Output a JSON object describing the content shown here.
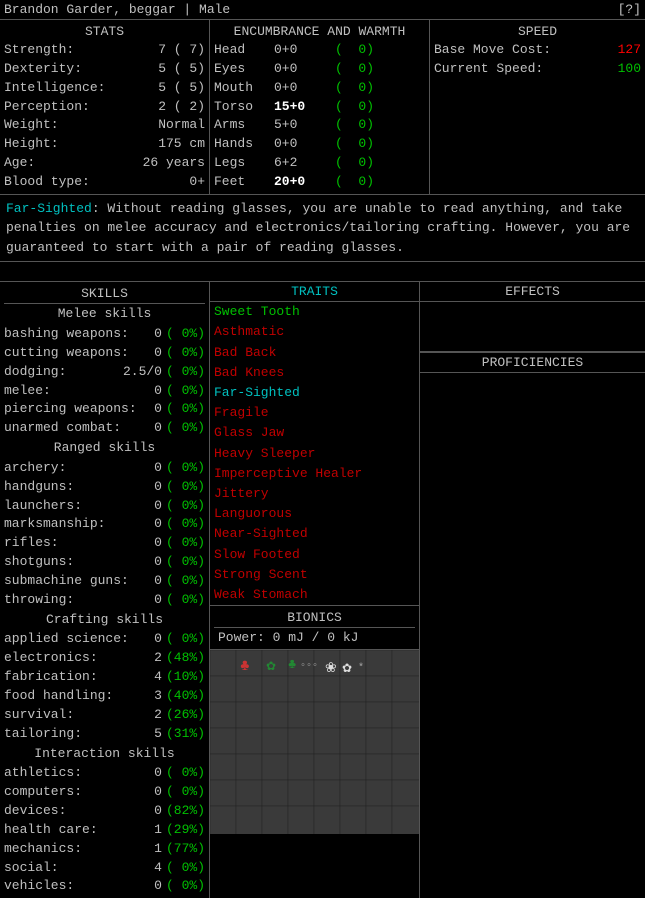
{
  "topbar": {
    "char_info": "Brandon Garder, beggar | Male",
    "help": "[?]"
  },
  "stats_header": "STATS",
  "stats": [
    {
      "label": "Strength:",
      "value": "7 ( 7)"
    },
    {
      "label": "Dexterity:",
      "value": "5 ( 5)"
    },
    {
      "label": "Intelligence:",
      "value": "5 ( 5)"
    },
    {
      "label": "Perception:",
      "value": "2 ( 2)"
    },
    {
      "label": "Weight:",
      "value": "Normal"
    },
    {
      "label": "Height:",
      "value": "175 cm"
    },
    {
      "label": "Age:",
      "value": "26 years"
    },
    {
      "label": "Blood type:",
      "value": "0+"
    }
  ],
  "enc_header": "ENCUMBRANCE AND WARMTH",
  "enc": [
    {
      "part": "Head",
      "val": "0+0",
      "warm": "0)"
    },
    {
      "part": "Eyes",
      "val": "0+0",
      "warm": "0)"
    },
    {
      "part": "Mouth",
      "val": "0+0",
      "warm": "0)"
    },
    {
      "part": "Torso",
      "val": "15+0",
      "warm": "0)",
      "highlight": true
    },
    {
      "part": "Arms",
      "val": "5+0",
      "warm": "0)"
    },
    {
      "part": "Hands",
      "val": "0+0",
      "warm": "0)"
    },
    {
      "part": "Legs",
      "val": "6+2",
      "warm": "0)"
    },
    {
      "part": "Feet",
      "val": "20+0",
      "warm": "0)",
      "highlight": true
    }
  ],
  "speed_header": "SPEED",
  "speed": {
    "base_label": "Base Move Cost:",
    "base_val": "127",
    "current_label": "Current Speed:",
    "current_val": "100"
  },
  "desc": {
    "highlight_word": "Far-Sighted",
    "text": ": Without reading glasses, you are unable to read anything, and take penalties on melee accuracy and electronics/tailoring crafting.  However, you are guaranteed to start with a pair of reading glasses."
  },
  "skills_header": "SKILLS",
  "melee_header": "Melee skills",
  "melee_skills": [
    {
      "name": "bashing weapons:",
      "val": "0",
      "pct": "( 0%)"
    },
    {
      "name": "cutting weapons:",
      "val": "0",
      "pct": "( 0%)"
    },
    {
      "name": "dodging:",
      "val": "2.5/0",
      "pct": "( 0%)"
    },
    {
      "name": "melee:",
      "val": "0",
      "pct": "( 0%)"
    },
    {
      "name": "piercing weapons:",
      "val": "0",
      "pct": "( 0%)"
    },
    {
      "name": "unarmed combat:",
      "val": "0",
      "pct": "( 0%)"
    }
  ],
  "ranged_header": "Ranged skills",
  "ranged_skills": [
    {
      "name": "archery:",
      "val": "0",
      "pct": "( 0%)"
    },
    {
      "name": "handguns:",
      "val": "0",
      "pct": "( 0%)"
    },
    {
      "name": "launchers:",
      "val": "0",
      "pct": "( 0%)"
    },
    {
      "name": "marksmanship:",
      "val": "0",
      "pct": "( 0%)"
    },
    {
      "name": "rifles:",
      "val": "0",
      "pct": "( 0%)"
    },
    {
      "name": "shotguns:",
      "val": "0",
      "pct": "( 0%)"
    },
    {
      "name": "submachine guns:",
      "val": "0",
      "pct": "( 0%)"
    },
    {
      "name": "throwing:",
      "val": "0",
      "pct": "( 0%)"
    }
  ],
  "crafting_header": "Crafting skills",
  "crafting_skills": [
    {
      "name": "applied science:",
      "val": "0",
      "pct": "( 0%)"
    },
    {
      "name": "electronics:",
      "val": "2",
      "pct": "(48%)"
    },
    {
      "name": "fabrication:",
      "val": "4",
      "pct": "(10%)"
    },
    {
      "name": "food handling:",
      "val": "3",
      "pct": "(40%)"
    },
    {
      "name": "survival:",
      "val": "2",
      "pct": "(26%)"
    },
    {
      "name": "tailoring:",
      "val": "5",
      "pct": "(31%)"
    }
  ],
  "interaction_header": "Interaction skills",
  "interaction_skills": [
    {
      "name": "athletics:",
      "val": "0",
      "pct": "( 0%)"
    },
    {
      "name": "computers:",
      "val": "0",
      "pct": "( 0%)"
    },
    {
      "name": "devices:",
      "val": "0",
      "pct": "(82%)"
    },
    {
      "name": "health care:",
      "val": "1",
      "pct": "(29%)"
    },
    {
      "name": "mechanics:",
      "val": "1",
      "pct": "(77%)"
    },
    {
      "name": "social:",
      "val": "4",
      "pct": "( 0%)"
    },
    {
      "name": "vehicles:",
      "val": "0",
      "pct": "( 0%)"
    }
  ],
  "traits_header": "TRAITS",
  "traits": [
    {
      "name": "Sweet Tooth",
      "color": "green"
    },
    {
      "name": "Asthmatic",
      "color": "red"
    },
    {
      "name": "Bad Back",
      "color": "red"
    },
    {
      "name": "Bad Knees",
      "color": "red"
    },
    {
      "name": "Far-Sighted",
      "color": "cyan"
    },
    {
      "name": "Fragile",
      "color": "red"
    },
    {
      "name": "Glass Jaw",
      "color": "red"
    },
    {
      "name": "Heavy Sleeper",
      "color": "red"
    },
    {
      "name": "Imperceptive Healer",
      "color": "red"
    },
    {
      "name": "Jittery",
      "color": "red"
    },
    {
      "name": "Languorous",
      "color": "red"
    },
    {
      "name": "Near-Sighted",
      "color": "red"
    },
    {
      "name": "Slow Footed",
      "color": "red"
    },
    {
      "name": "Strong Scent",
      "color": "red"
    },
    {
      "name": "Weak Stomach",
      "color": "red"
    }
  ],
  "bionics_header": "BIONICS",
  "bionics_power": "Power: 0 mJ / 0 kJ",
  "effects_header": "EFFECTS",
  "proficiencies_header": "PROFICIENCIES"
}
